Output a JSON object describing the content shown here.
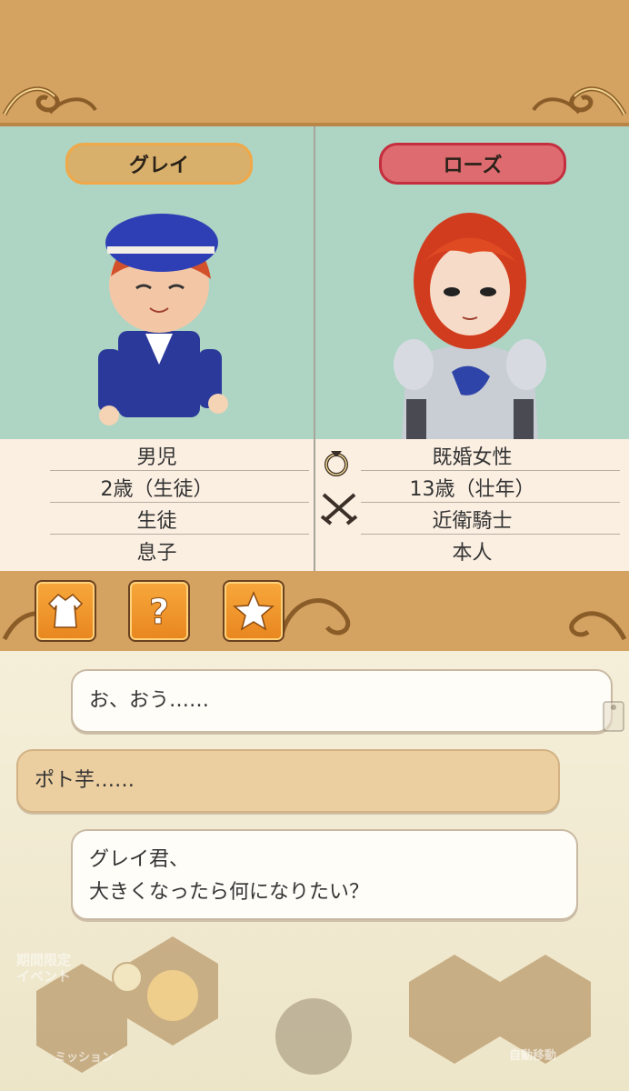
{
  "characters": {
    "left": {
      "name": "グレイ",
      "info": [
        "男児",
        "2歳（生徒）",
        "生徒",
        "息子"
      ]
    },
    "right": {
      "name": "ローズ",
      "info": [
        "既婚女性",
        "13歳（壮年）",
        "近衛騎士",
        "本人"
      ]
    }
  },
  "icons": {
    "ring": "ring-icon",
    "swords": "crossed-swords-icon",
    "toolbar": [
      "outfit-icon",
      "question-icon",
      "star-icon"
    ]
  },
  "dialogue": [
    {
      "speaker": "right",
      "text": "お、おう……"
    },
    {
      "speaker": "left",
      "text": "ポト芋……"
    },
    {
      "speaker": "right",
      "lines": [
        "グレイ君、",
        "大きくなったら何になりたい？"
      ]
    }
  ],
  "hud": {
    "event_badge": [
      "期間限定",
      "イベント"
    ],
    "mission_label": "ミッション",
    "auto_move_label": "自動移動"
  },
  "colors": {
    "banner": "#d4a261",
    "panel_bg": "#aed4c3",
    "grey_pill": "#d8b06c",
    "rose_pill": "#dd6b70",
    "button_orange": "#f7a83c"
  }
}
